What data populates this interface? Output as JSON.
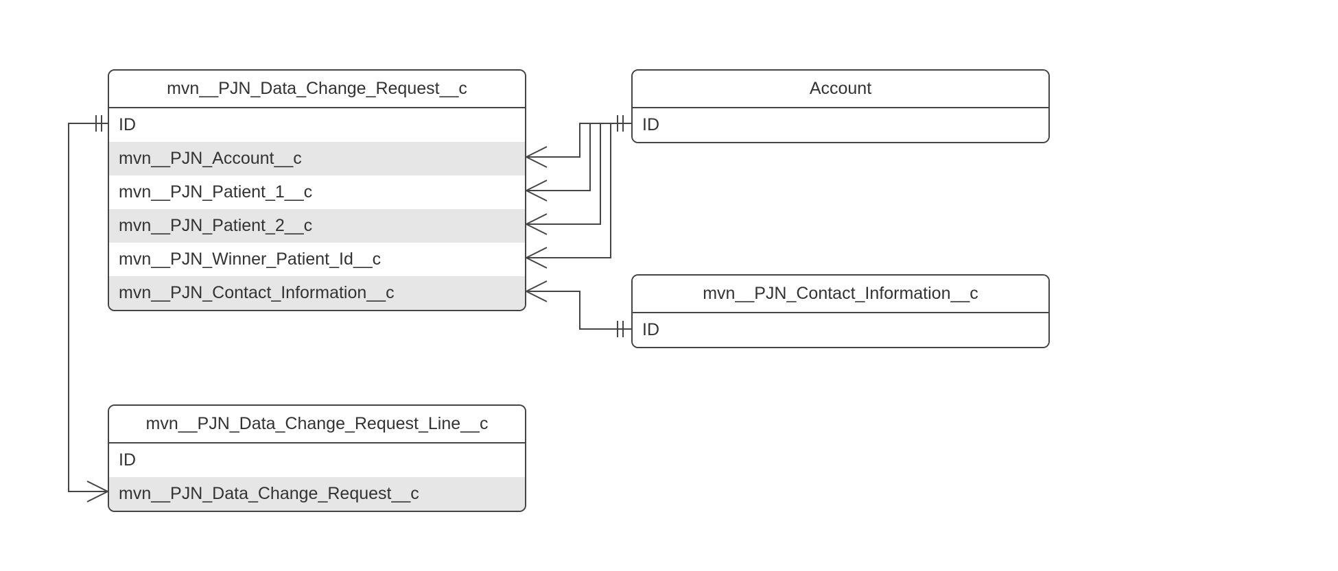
{
  "diagram": {
    "entities": {
      "dcr": {
        "title": "mvn__PJN_Data_Change_Request__c",
        "rows": [
          {
            "label": "ID",
            "shaded": false
          },
          {
            "label": "mvn__PJN_Account__c",
            "shaded": true
          },
          {
            "label": "mvn__PJN_Patient_1__c",
            "shaded": false
          },
          {
            "label": "mvn__PJN_Patient_2__c",
            "shaded": true
          },
          {
            "label": "mvn__PJN_Winner_Patient_Id__c",
            "shaded": false
          },
          {
            "label": "mvn__PJN_Contact_Information__c",
            "shaded": true
          }
        ]
      },
      "account": {
        "title": "Account",
        "rows": [
          {
            "label": "ID",
            "shaded": false
          }
        ]
      },
      "contactinfo": {
        "title": "mvn__PJN_Contact_Information__c",
        "rows": [
          {
            "label": "ID",
            "shaded": false
          }
        ]
      },
      "dcrline": {
        "title": "mvn__PJN_Data_Change_Request_Line__c",
        "rows": [
          {
            "label": "ID",
            "shaded": false
          },
          {
            "label": "mvn__PJN_Data_Change_Request__c",
            "shaded": true
          }
        ]
      }
    },
    "relationships": [
      {
        "from": "dcr.mvn__PJN_Account__c",
        "to": "account.ID",
        "type": "many-to-one"
      },
      {
        "from": "dcr.mvn__PJN_Patient_1__c",
        "to": "account.ID",
        "type": "many-to-one"
      },
      {
        "from": "dcr.mvn__PJN_Patient_2__c",
        "to": "account.ID",
        "type": "many-to-one"
      },
      {
        "from": "dcr.mvn__PJN_Winner_Patient_Id__c",
        "to": "account.ID",
        "type": "many-to-one"
      },
      {
        "from": "dcr.mvn__PJN_Contact_Information__c",
        "to": "contactinfo.ID",
        "type": "many-to-one"
      },
      {
        "from": "dcrline.mvn__PJN_Data_Change_Request__c",
        "to": "dcr.ID",
        "type": "many-to-one"
      }
    ]
  }
}
